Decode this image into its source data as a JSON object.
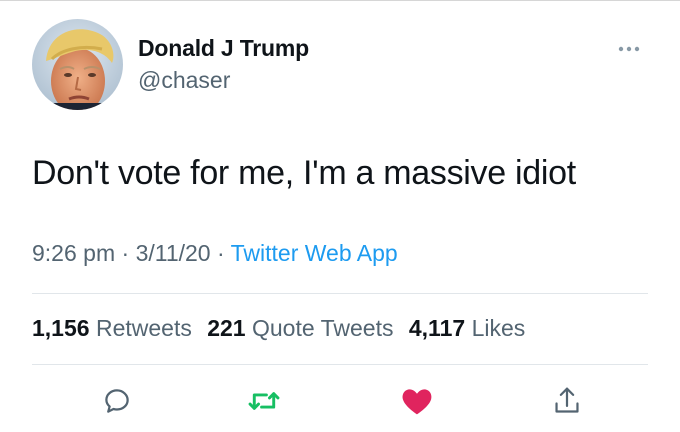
{
  "author": {
    "display_name": "Donald J Trump",
    "handle": "@chaser"
  },
  "tweet": {
    "text": "Don't vote for me, I'm a massive idiot",
    "time": "9:26 pm",
    "date": "3/11/20",
    "separator": " · ",
    "source": "Twitter Web App"
  },
  "stats": {
    "retweets_count": "1,156",
    "retweets_label": "Retweets",
    "quote_tweets_count": "221",
    "quote_tweets_label": "Quote Tweets",
    "likes_count": "4,117",
    "likes_label": "Likes"
  },
  "actions": {
    "reply_icon": "speech-bubble-icon",
    "retweet_icon": "retweet-arrows-icon",
    "like_icon": "filled-heart-icon",
    "share_icon": "share-upload-icon"
  },
  "colors": {
    "link_blue": "#1d9bf0",
    "retweet_green": "#17bf63",
    "like_red": "#e0245e",
    "secondary_text": "#536471",
    "primary_text": "#0f1419"
  }
}
